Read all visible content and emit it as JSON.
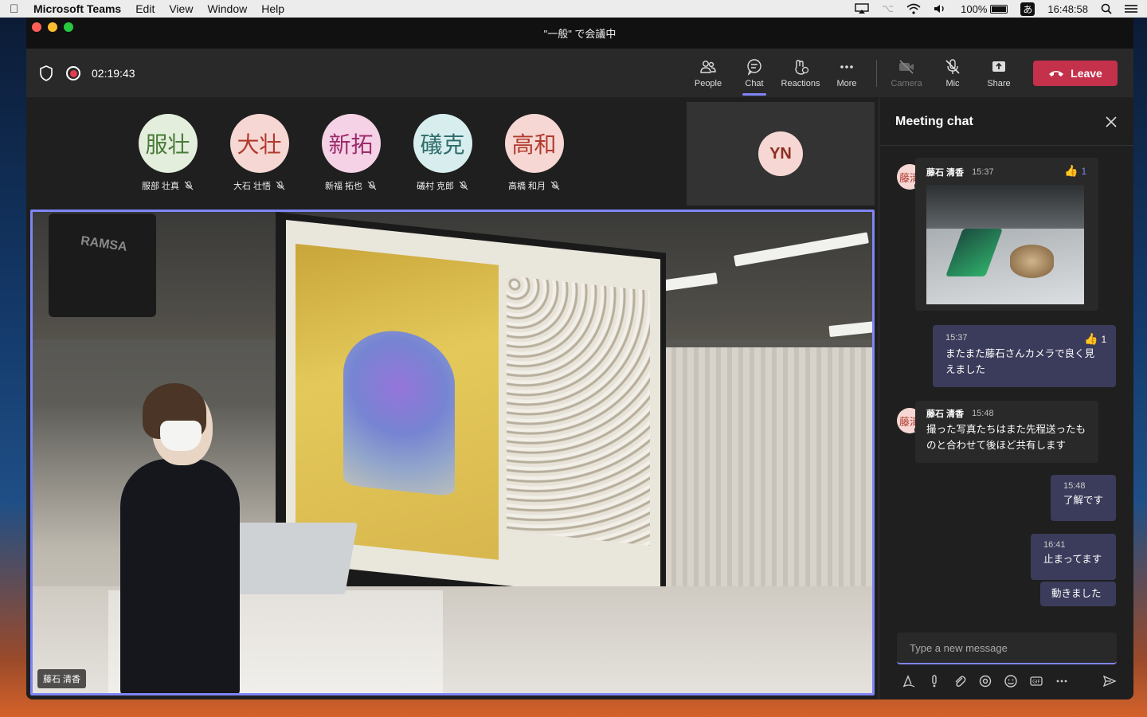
{
  "menubar": {
    "app_name": "Microsoft Teams",
    "menus": [
      "Edit",
      "View",
      "Window",
      "Help"
    ],
    "battery": "100%",
    "ime": "あ",
    "clock": "16:48:58"
  },
  "window": {
    "title": "\"一般\" で会議中"
  },
  "toolbar": {
    "timer": "02:19:43",
    "tools": {
      "people": "People",
      "chat": "Chat",
      "reactions": "Reactions",
      "more": "More",
      "camera": "Camera",
      "mic": "Mic",
      "share": "Share"
    },
    "leave_label": "Leave"
  },
  "participants": [
    {
      "initials": "服壮",
      "name": "服部 壮真",
      "bg": "#e3efdc",
      "fg": "#4a7a3a"
    },
    {
      "initials": "大壮",
      "name": "大石 壮悟",
      "bg": "#f6d7d3",
      "fg": "#b03a2e"
    },
    {
      "initials": "新拓",
      "name": "新福 拓也",
      "bg": "#f5d2e6",
      "fg": "#9c2c6b"
    },
    {
      "initials": "礒克",
      "name": "礒村 克郎",
      "bg": "#d8eeee",
      "fg": "#2e6b6b"
    },
    {
      "initials": "高和",
      "name": "高橋 和月",
      "bg": "#f6d7d3",
      "fg": "#b03a2e"
    }
  ],
  "yn_tile": {
    "initials": "YN"
  },
  "video": {
    "speaker_label": "藤石 清香",
    "brand_text": "RAMSA"
  },
  "chat": {
    "title": "Meeting chat",
    "messages": [
      {
        "avatar": "藤清",
        "author": "藤石 清香",
        "time": "15:37",
        "reaction_count": "1"
      },
      {
        "time": "15:37",
        "text": "またまた藤石さんカメラで良く見えました",
        "reaction_count": "1"
      },
      {
        "avatar": "藤清",
        "author": "藤石 清香",
        "time": "15:48",
        "text": "撮った写真たちはまた先程送ったものと合わせて後ほど共有します"
      },
      {
        "time": "15:48",
        "text": "了解です"
      },
      {
        "time": "16:41",
        "text": "止まってます"
      },
      {
        "text": "動きました"
      }
    ],
    "compose_placeholder": "Type a new message"
  },
  "colors": {
    "accent": "#7f85f5",
    "leave": "#c4314b",
    "outgoing_bubble": "#3b3b5b"
  }
}
